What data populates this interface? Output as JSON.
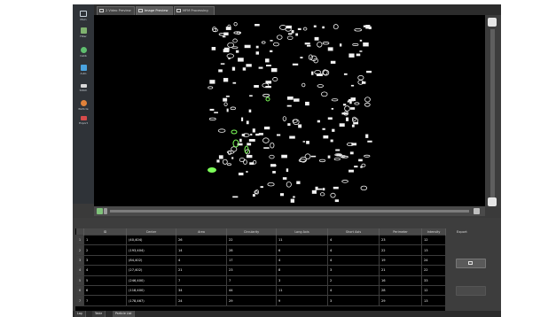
{
  "sidebar": {
    "items": [
      {
        "label": "Main",
        "icon": "monitor-icon",
        "color": "#c9d3dc"
      },
      {
        "label": "Filter",
        "icon": "filter-icon",
        "color": "#7fb26f"
      },
      {
        "label": "Calib",
        "icon": "calibrate-icon",
        "color": "#5fbf6f"
      },
      {
        "label": "Auto",
        "icon": "auto-icon",
        "color": "#4aa3df"
      },
      {
        "label": "Stitch",
        "icon": "stitch-icon",
        "color": "#d9d9d9"
      },
      {
        "label": "Particle",
        "icon": "particle-icon",
        "color": "#e0823a"
      },
      {
        "label": "Export",
        "icon": "export-icon",
        "color": "#d64b4b"
      }
    ]
  },
  "tabs": [
    {
      "label": "2 Video Preview",
      "icon": "video-icon"
    },
    {
      "label": "Image Preview",
      "icon": "image-icon"
    },
    {
      "label": "MFM Processing",
      "icon": "processing-icon"
    }
  ],
  "table": {
    "columns": [
      "ID",
      "Center",
      "Area",
      "Circularity",
      "Long Axis",
      "Short Axis",
      "Perimeter",
      "Intensity"
    ],
    "rows": [
      {
        "n": "1",
        "cells": [
          "1",
          "(40,404)",
          "26",
          "22",
          "11",
          "4",
          "23",
          "12"
        ]
      },
      {
        "n": "2",
        "cells": [
          "2",
          "(193,404)",
          "14",
          "28",
          "6",
          "4",
          "22",
          "13"
        ]
      },
      {
        "n": "3",
        "cells": [
          "3",
          "(84,402)",
          "4",
          "17",
          "4",
          "4",
          "19",
          "24"
        ]
      },
      {
        "n": "4",
        "cells": [
          "4",
          "(27,402)",
          "21",
          "23",
          "8",
          "3",
          "21",
          "22"
        ]
      },
      {
        "n": "5",
        "cells": [
          "5",
          "(246,400)",
          "7",
          "7",
          "3",
          "2",
          "16",
          "33"
        ]
      },
      {
        "n": "6",
        "cells": [
          "6",
          "(118,400)",
          "34",
          "44",
          "11",
          "4",
          "28",
          "12"
        ]
      },
      {
        "n": "7",
        "cells": [
          "7",
          "(178,467)",
          "24",
          "29",
          "9",
          "3",
          "29",
          "13"
        ]
      }
    ]
  },
  "export": {
    "label": "Export",
    "button_icon": "export-file-icon"
  },
  "bottom_tabs": [
    "Log",
    "Table",
    "Particle List"
  ],
  "colors": {
    "particle_outline": "#f2f2f2",
    "highlight": "#7dff5a",
    "background": "#000000"
  }
}
